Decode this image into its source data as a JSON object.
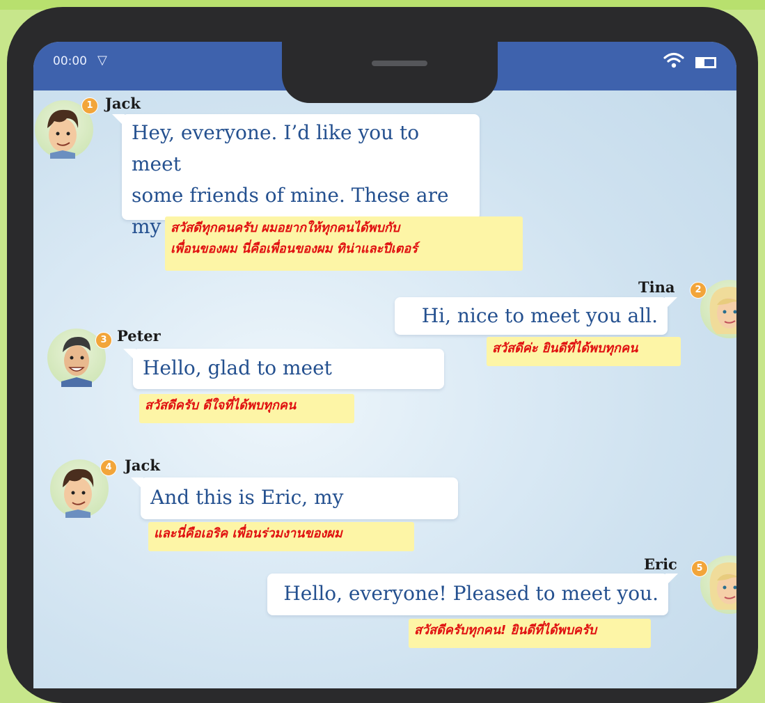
{
  "status_bar": {
    "time": "00:00",
    "signal_glyph": "▽",
    "wifi_icon": "wifi-icon",
    "battery_icon": "battery-icon"
  },
  "messages": [
    {
      "badge": "1",
      "name": "Jack",
      "lines": [
        "Hey, everyone. I’d like you to meet",
        "some friends of mine. These are",
        "my friends, Tina and Peter."
      ],
      "translation_lines": [
        "สวัสดีทุกคนครับ ผมอยากให้ทุกคนได้พบกับ",
        "เพื่อนของผม นี่คือเพื่อนของผม ทิน่าและปีเตอร์"
      ]
    },
    {
      "badge": "2",
      "name": "Tina",
      "lines": [
        "Hi, nice to meet you all."
      ],
      "translation_lines": [
        "สวัสดีค่ะ ยินดีที่ได้พบทุกคน"
      ]
    },
    {
      "badge": "3",
      "name": "Peter",
      "lines": [
        "Hello, glad to meet everyone."
      ],
      "translation_lines": [
        "สวัสดีครับ ดีใจที่ได้พบทุกคน"
      ]
    },
    {
      "badge": "4",
      "name": "Jack",
      "lines": [
        "And this is Eric, my colleague."
      ],
      "translation_lines": [
        "และนี่คือเอริค เพื่อนร่วมงานของผม"
      ]
    },
    {
      "badge": "5",
      "name": "Eric",
      "lines": [
        "Hello, everyone! Pleased to meet you."
      ],
      "translation_lines": [
        "สวัสดีครับทุกคน! ยินดีที่ได้พบครับ"
      ]
    }
  ],
  "colors": {
    "header": "#3e62ad",
    "bubble_text": "#24508f",
    "translation_bg": "#fdf5a6",
    "translation_text": "#e01010",
    "badge": "#f2a53a"
  }
}
